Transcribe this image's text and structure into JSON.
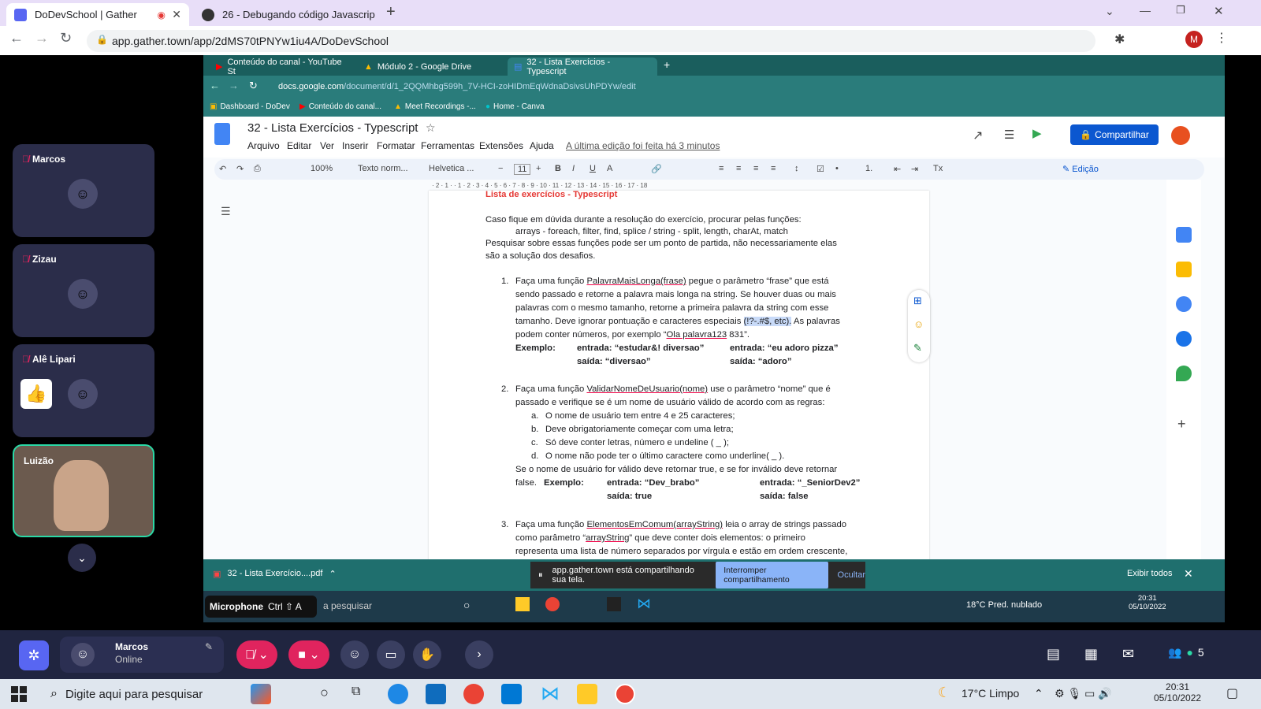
{
  "outer_browser": {
    "tabs": [
      {
        "label": "DoDevSchool | Gather",
        "active": true
      },
      {
        "label": "26 - Debugando código Javascrip",
        "active": false
      }
    ],
    "new_tab": "+",
    "url": "app.gather.town/app/2dMS70tPNYw1iu4A/DoDevSchool",
    "profile_initial": "M"
  },
  "gather": {
    "participants": [
      {
        "name": "Marcos",
        "muted": true
      },
      {
        "name": "Zizau",
        "muted": true
      },
      {
        "name": "Alê Lipari",
        "muted": true,
        "reaction": "👍"
      },
      {
        "name": "Luizão",
        "muted": false,
        "video": true
      }
    ],
    "microphone_tooltip": "Microphone",
    "microphone_shortcut": "Ctrl ⇧ A",
    "user_name": "Marcos",
    "user_status": "Online",
    "participant_count": "5"
  },
  "inner_browser": {
    "tabs": [
      {
        "label": "Conteúdo do canal - YouTube St"
      },
      {
        "label": "Módulo 2 - Google Drive"
      },
      {
        "label": "32 - Lista Exercícios - Typescript",
        "active": true
      }
    ],
    "url_host": "docs.google.com",
    "url_path": "/document/d/1_2QQMhbg599h_7V-HCI-zoHIDmEqWdnaDsivsUhPDYw/edit",
    "bookmarks": [
      "Dashboard - DoDev",
      "Conteúdo do canal...",
      "Meet Recordings -...",
      "Home - Canva"
    ]
  },
  "docs": {
    "title": "32 - Lista Exercícios - Typescript",
    "menu": [
      "Arquivo",
      "Editar",
      "Ver",
      "Inserir",
      "Formatar",
      "Ferramentas",
      "Extensões",
      "Ajuda"
    ],
    "last_edit": "A última edição foi feita há 3 minutos",
    "share_label": "Compartilhar",
    "zoom": "100%",
    "style": "Texto norm...",
    "font": "Helvetica ...",
    "font_size": "11",
    "mode": "Edição",
    "page": {
      "heading": "Lista de exercícios - Typescript",
      "intro1": "Caso fique em dúvida durante a resolução do exercício, procurar pelas funções:",
      "intro2": "arrays - foreach, filter, find, splice / string - split, length, charAt, match",
      "intro3": "Pesquisar sobre essas funções pode ser um ponto de partida, não necessariamente elas",
      "intro4": "são a solução dos desafios.",
      "q1_num": "1.",
      "q1_l1a": "Faça uma função ",
      "q1_l1b": "PalavraMaisLonga(frase)",
      "q1_l1c": " pegue o parâmetro “frase” que está",
      "q1_l2": "sendo passado e retorne a palavra mais longa na string. Se houver duas ou mais",
      "q1_l3": "palavras com o mesmo tamanho, retorne a primeira palavra da string com esse",
      "q1_l4a": "tamanho. Deve ignorar pontuação e caracteres especiais ",
      "q1_l4b": "(!?-.#$, etc).",
      "q1_l4c": " As palavras",
      "q1_l5a": "podem conter números, por exemplo “",
      "q1_l5b": "Ola palavra123",
      "q1_l5c": " 831”.",
      "q1_ex_label": "Exemplo:",
      "q1_ex1_in": "entrada: “estudar&! diversao”",
      "q1_ex1_out": "saída: “diversao”",
      "q1_ex2_in": "entrada: “eu adoro pizza”",
      "q1_ex2_out": "saída: “adoro”",
      "q2_num": "2.",
      "q2_l1a": "Faça uma função ",
      "q2_l1b": "ValidarNomeDeUsuario(nome)",
      "q2_l1c": " use o parâmetro “nome” que é",
      "q2_l2": "passado e verifique se é um nome de usuário válido de acordo com as regras:",
      "q2_rules": [
        {
          "m": "a.",
          "t": "O nome de usuário tem entre 4 e 25 caracteres;"
        },
        {
          "m": "b.",
          "t": "Deve obrigatoriamente começar com uma letra;"
        },
        {
          "m": "c.",
          "t": "Só deve conter letras, número e undeline ( _ );"
        },
        {
          "m": "d.",
          "t": "O nome não pode ter o último caractere como underline( _ )."
        }
      ],
      "q2_l7": "Se o nome de usuário for válido deve retornar true, e se for inválido deve retornar",
      "q2_false": "false.",
      "q2_ex_label": "Exemplo:",
      "q2_ex1_in": "entrada: “Dev_brabo”",
      "q2_ex1_out": "saída: true",
      "q2_ex2_in": "entrada: “_SeniorDev2”",
      "q2_ex2_out": "saída: false",
      "q3_num": "3.",
      "q3_l1a": "Faça uma função ",
      "q3_l1b": "ElementosEmComum(arrayString)",
      "q3_l1c": " leia o array de strings passado",
      "q3_l2a": "como parâmetro “",
      "q3_l2b": "arrayString",
      "q3_l2c": "” que deve conter dois elementos: o primeiro",
      "q3_l3": "representa uma lista de número separados por vírgula e estão em ordem crescente,"
    }
  },
  "share_bar": {
    "download_file": "32 - Lista Exercício....pdf",
    "message": "app.gather.town está compartilhando sua tela.",
    "stop": "Interromper compartilhamento",
    "hide": "Ocultar",
    "show_all": "Exibir todos"
  },
  "inner_taskbar": {
    "search": "a pesquisar",
    "weather": "18°C  Pred. nublado",
    "time": "20:31",
    "date": "05/10/2022"
  },
  "windows_taskbar": {
    "search": "Digite aqui para pesquisar",
    "weather": "17°C  Limpo",
    "time": "20:31",
    "date": "05/10/2022"
  }
}
